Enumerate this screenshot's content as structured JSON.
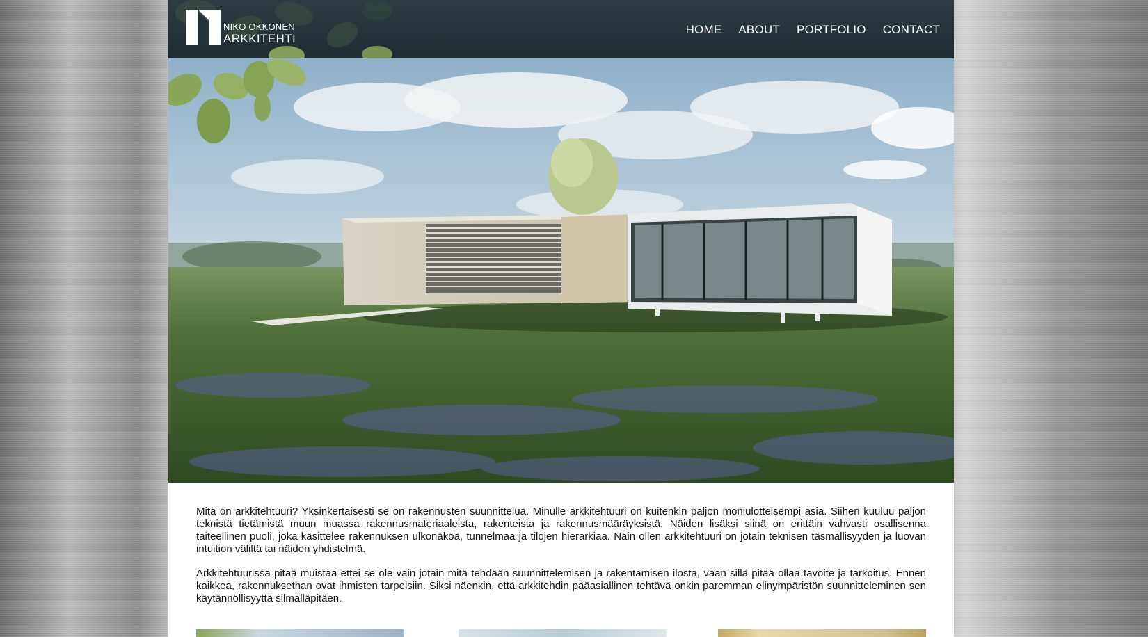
{
  "brand": {
    "name": "NIKO OKKONEN",
    "title": "ARKKITEHTI"
  },
  "nav": {
    "items": [
      {
        "label": "HOME"
      },
      {
        "label": "ABOUT"
      },
      {
        "label": "PORTFOLIO"
      },
      {
        "label": "CONTACT"
      }
    ]
  },
  "hero": {
    "image": "modern-house-in-meadow"
  },
  "content": {
    "paragraphs": [
      "Mitä on arkkitehtuuri? Yksinkertaisesti se on rakennusten suunnittelua. Minulle arkkitehtuuri on kuitenkin paljon moniulotteisempi asia. Siihen kuuluu paljon teknistä tietämistä muun muassa rakennusmateriaaleista, rakenteista ja rakennusmääräyksistä. Näiden lisäksi siinä on erittäin vahvasti osallisenna taiteellinen puoli, joka käsittelee rakennuksen ulkonäköä, tunnelmaa ja tilojen hierarkiaa. Näin ollen arkkitehtuuri on jotain teknisen täsmällisyyden ja luovan intuition väliltä tai näiden yhdistelmä.",
      "Arkkitehtuurissa pitää muistaa ettei se ole vain jotain mitä tehdään suunnittelemisen ja rakentamisen ilosta, vaan sillä pitää ollaa tavoite ja tarkoitus. Ennen kaikkea, rakennuksethan ovat ihmisten tarpeisiin. Siksi näenkin, että arkkitehdin pääasiallinen tehtävä onkin paremman elinympäristön suunnitteleminen sen käytännöllisyyttä silmälläpitäen."
    ]
  },
  "colors": {
    "header_bg": "#243239",
    "page_bg": "#ffffff",
    "text": "#111111",
    "nav_text": "#ffffff"
  }
}
